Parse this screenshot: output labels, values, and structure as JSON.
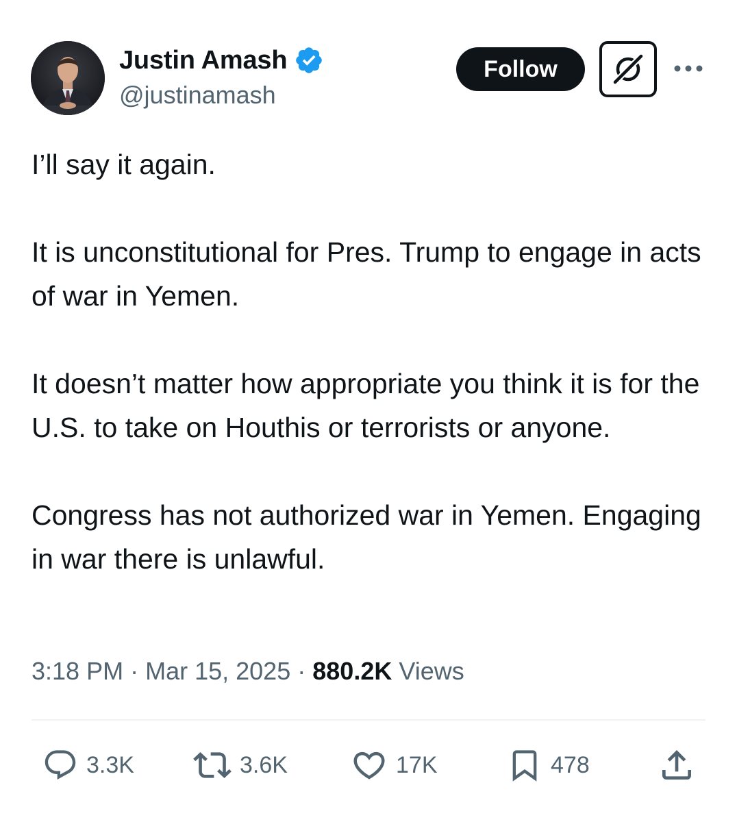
{
  "author": {
    "display_name": "Justin Amash",
    "handle": "@justinamash",
    "verified": true,
    "verified_color": "#1d9bf0"
  },
  "header": {
    "follow_label": "Follow",
    "grok_icon": "grok-icon",
    "more_icon": "more-icon"
  },
  "tweet": {
    "paragraphs": [
      "I’ll say it again.",
      "It is unconstitutional for Pres. Trump to engage in acts of war in Yemen.",
      "It doesn’t matter how appropriate you think it is for the U.S. to take on Houthis or terrorists or anyone.",
      "Congress has not authorized war in Yemen. Engaging in war there is unlawful."
    ]
  },
  "meta": {
    "time": "3:18 PM",
    "date": "Mar 15, 2025",
    "views_count": "880.2K",
    "views_label": "Views"
  },
  "actions": {
    "replies": "3.3K",
    "reposts": "3.6K",
    "likes": "17K",
    "bookmarks": "478"
  },
  "colors": {
    "text": "#0f1419",
    "secondary": "#536471",
    "divider": "#eff3f4"
  }
}
